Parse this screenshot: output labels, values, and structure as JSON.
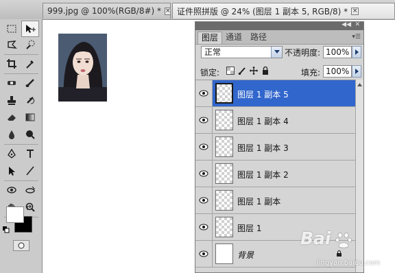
{
  "tabs": [
    {
      "label": "999.jpg @ 100%(RGB/8#) *",
      "close": "×"
    },
    {
      "label": "证件照拼版 @ 24% (图层 1 副本 5, RGB/8) *",
      "close": "×"
    }
  ],
  "tools": [
    "rectangular-marquee-icon",
    "move-icon",
    "lasso-icon",
    "quick-selection-icon",
    "crop-icon",
    "eyedropper-icon",
    "healing-brush-icon",
    "brush-icon",
    "clone-stamp-icon",
    "history-brush-icon",
    "eraser-icon",
    "gradient-icon",
    "blur-icon",
    "dodge-icon",
    "pen-icon",
    "type-icon",
    "path-selection-icon",
    "line-icon",
    "rotate-3d-icon",
    "orbit-3d-icon",
    "hand-icon",
    "zoom-icon"
  ],
  "colors": {
    "foreground": "#ffffff",
    "background": "#000000",
    "selection": "#3166cc"
  },
  "layers_panel": {
    "tabs": [
      "图层",
      "通道",
      "路径"
    ],
    "blend_mode": "正常",
    "opacity_label": "不透明度:",
    "opacity_value": "100%",
    "lock_label": "锁定:",
    "fill_label": "填充:",
    "fill_value": "100%",
    "layers": [
      {
        "name": "图层 1 副本 5",
        "selected": true,
        "visible": true
      },
      {
        "name": "图层 1 副本 4",
        "selected": false,
        "visible": true
      },
      {
        "name": "图层 1 副本 3",
        "selected": false,
        "visible": true
      },
      {
        "name": "图层 1 副本 2",
        "selected": false,
        "visible": true
      },
      {
        "name": "图层 1 副本",
        "selected": false,
        "visible": true
      },
      {
        "name": "图层 1",
        "selected": false,
        "visible": true
      },
      {
        "name": "背景",
        "selected": false,
        "visible": true,
        "locked": true
      }
    ]
  },
  "watermark": {
    "logo": "Bai",
    "url": "jingyan.baidu.com"
  }
}
